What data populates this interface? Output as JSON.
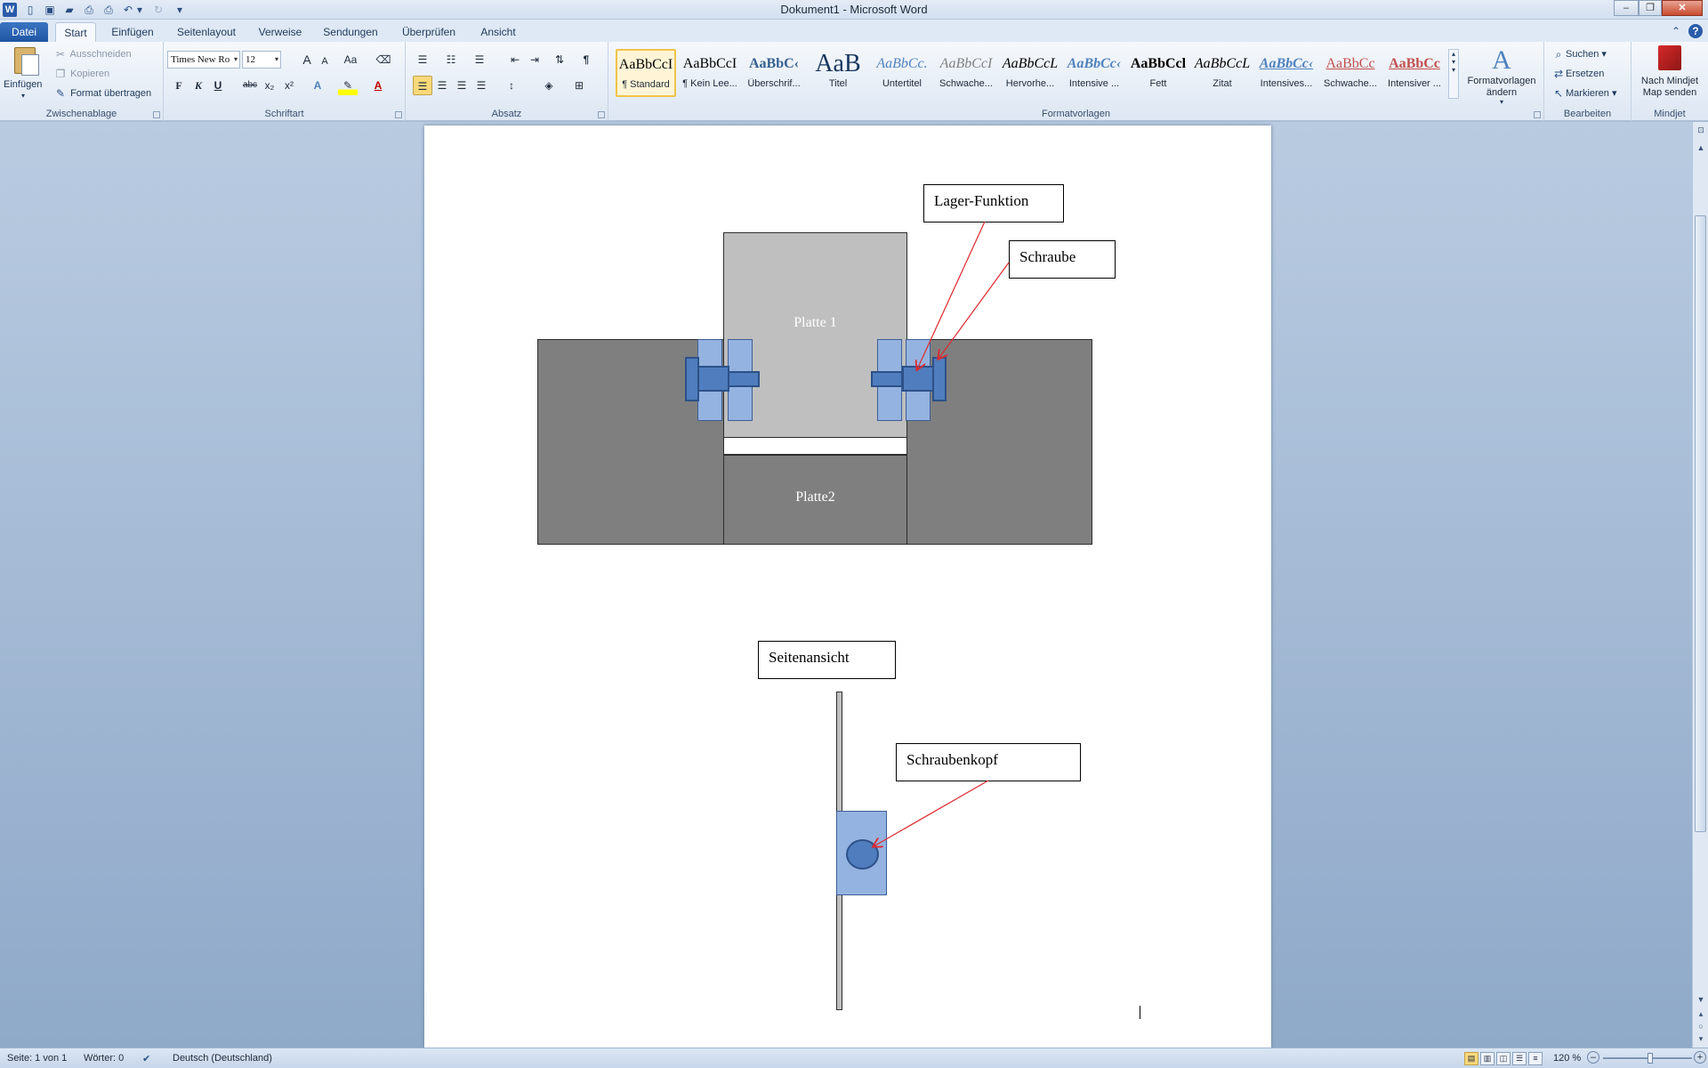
{
  "window": {
    "title": "Dokument1 - Microsoft Word",
    "minimize_symbol": "–",
    "maximize_symbol": "❐",
    "close_symbol": "✕"
  },
  "quick_access": [
    {
      "icon": "word-logo-icon",
      "glyph": "W"
    },
    {
      "icon": "new-document-icon",
      "glyph": "▯"
    },
    {
      "icon": "save-icon",
      "glyph": "▣"
    },
    {
      "icon": "open-folder-icon",
      "glyph": "▰"
    },
    {
      "icon": "print-preview-icon",
      "glyph": "⎙"
    },
    {
      "icon": "quick-print-icon",
      "glyph": "⎙"
    },
    {
      "icon": "undo-icon",
      "glyph": "↶"
    },
    {
      "icon": "undo-dropdown-icon",
      "glyph": "▾"
    },
    {
      "icon": "redo-icon",
      "glyph": "↻"
    },
    {
      "icon": "customize-qat-icon",
      "glyph": "▾"
    }
  ],
  "tabs": [
    {
      "label": "Datei"
    },
    {
      "label": "Start"
    },
    {
      "label": "Einfügen"
    },
    {
      "label": "Seitenlayout"
    },
    {
      "label": "Verweise"
    },
    {
      "label": "Sendungen"
    },
    {
      "label": "Überprüfen"
    },
    {
      "label": "Ansicht"
    }
  ],
  "ribbon": {
    "clipboard": {
      "label": "Zwischenablage",
      "paste": "Einfügen",
      "cut": "Ausschneiden",
      "copy": "Kopieren",
      "format_painter": "Format übertragen"
    },
    "font": {
      "label": "Schriftart",
      "family": "Times New Ro",
      "size": "12",
      "bold": "F",
      "italic": "K",
      "underline": "U",
      "strikethrough": "abc",
      "subscript": "x₂",
      "superscript": "x²",
      "grow": "A",
      "shrink": "A",
      "change_case": "Aa",
      "font_color_glyph": "A"
    },
    "paragraph": {
      "label": "Absatz",
      "show_marks": "¶"
    },
    "styles": {
      "label": "Formatvorlagen",
      "items": [
        {
          "sample": "AaBbCcI",
          "name": "¶ Standard",
          "color": "#000000"
        },
        {
          "sample": "AaBbCcI",
          "name": "¶ Kein Lee...",
          "color": "#000000"
        },
        {
          "sample": "AaBbC‹",
          "name": "Überschrif...",
          "color": "#365f91"
        },
        {
          "sample": "AaB",
          "name": "Titel",
          "color": "#17365d"
        },
        {
          "sample": "AaBbCc.",
          "name": "Untertitel",
          "color": "#4f81bd"
        },
        {
          "sample": "AaBbCcI",
          "name": "Schwache...",
          "color": "#808080"
        },
        {
          "sample": "AaBbCcL",
          "name": "Hervorhe...",
          "color": "#000000"
        },
        {
          "sample": "AaBbCc‹",
          "name": "Intensive ...",
          "color": "#4f81bd"
        },
        {
          "sample": "AaBbCcl",
          "name": "Fett",
          "color": "#000000"
        },
        {
          "sample": "AaBbCcL",
          "name": "Zitat",
          "color": "#000000"
        },
        {
          "sample": "AaBbCc‹",
          "name": "Intensives...",
          "color": "#4f81bd"
        },
        {
          "sample": "AaBbCc",
          "name": "Schwache...",
          "color": "#c0504d"
        },
        {
          "sample": "AaBbCc",
          "name": "Intensiver ...",
          "color": "#c0504d"
        }
      ],
      "change_styles": "Formatvorlagen ändern"
    },
    "editing": {
      "label": "Bearbeiten",
      "find": "Suchen",
      "replace": "Ersetzen",
      "select": "Markieren"
    },
    "mindjet": {
      "label": "Mindjet",
      "send": "Nach Mindjet Map senden"
    }
  },
  "drawing": {
    "plate1": "Platte 1",
    "plate2": "Platte2",
    "callout_bearing": "Lager-Funktion",
    "callout_screw": "Schraube",
    "callout_side_view": "Seitenansicht",
    "callout_screw_head": "Schraubenkopf",
    "arrow_color": "#e0282d"
  },
  "statusbar": {
    "page": "Seite: 1 von 1",
    "words": "Wörter: 0",
    "language": "Deutsch (Deutschland)",
    "zoom": "120 %",
    "zoom_percent": 120
  }
}
